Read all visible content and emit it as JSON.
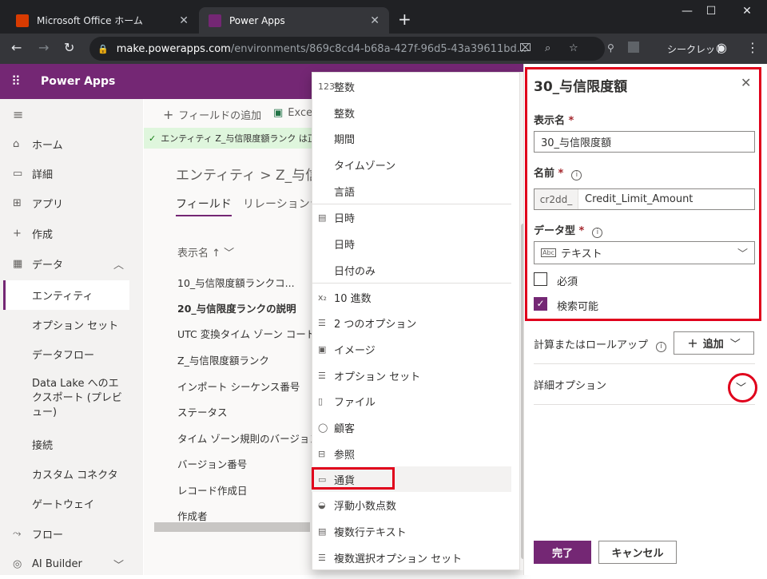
{
  "browser": {
    "tabs": [
      {
        "title": "Microsoft Office ホーム",
        "color": "#d83b01"
      },
      {
        "title": "Power Apps",
        "color": "#742774"
      }
    ],
    "url_host": "make.powerapps.com",
    "url_path": "/environments/869c8cd4-b68a-427f-96d5-43a39611bd...",
    "incognito": "シークレット"
  },
  "app": {
    "name": "Power Apps"
  },
  "nav": {
    "items": [
      {
        "label": "ホーム",
        "icon": "⌂"
      },
      {
        "label": "詳細",
        "icon": "▭"
      },
      {
        "label": "アプリ",
        "icon": "⊞"
      },
      {
        "label": "作成",
        "icon": "+"
      },
      {
        "label": "データ",
        "icon": "▦"
      },
      {
        "label": "エンティティ"
      },
      {
        "label": "オプション セット"
      },
      {
        "label": "データフロー"
      },
      {
        "label": "Data Lake へのエクスポート (プレビュー)"
      },
      {
        "label": "接続"
      },
      {
        "label": "カスタム コネクタ"
      },
      {
        "label": "ゲートウェイ"
      },
      {
        "label": "フロー",
        "icon": "⤳"
      },
      {
        "label": "AI Builder",
        "icon": "◎"
      }
    ]
  },
  "main": {
    "cmd_add": "フィールドの追加",
    "cmd_excel": "Excel",
    "notice": "エンティティ Z_与信限度額ランク は正",
    "breadcrumb": "エンティティ  >  Z_与信",
    "tabs": [
      "フィールド",
      "リレーションシ"
    ],
    "col_header": "表示名 ↑",
    "rows": [
      "10_与信限度額ランクコ...",
      "20_与信限度ランクの説明",
      "UTC 変換タイム ゾーン コード",
      "Z_与信限度額ランク",
      "インポート シーケンス番号",
      "ステータス",
      "タイム ゾーン規則のバージョン",
      "バージョン番号",
      "レコード作成日",
      "作成者"
    ]
  },
  "dropdown": {
    "items": [
      {
        "label": "整数",
        "type": "head",
        "icon": "123"
      },
      {
        "label": "整数",
        "type": "sub"
      },
      {
        "label": "期間",
        "type": "sub"
      },
      {
        "label": "タイムゾーン",
        "type": "sub"
      },
      {
        "label": "言語",
        "type": "sub"
      },
      {
        "label": "日時",
        "type": "head",
        "icon": "▤"
      },
      {
        "label": "日時",
        "type": "sub"
      },
      {
        "label": "日付のみ",
        "type": "sub"
      },
      {
        "label": "10 進数",
        "type": "head",
        "icon": "x₂"
      },
      {
        "label": "2 つのオプション",
        "type": "head",
        "icon": "☰"
      },
      {
        "label": "イメージ",
        "type": "head",
        "icon": "▣"
      },
      {
        "label": "オプション セット",
        "type": "head",
        "icon": "☰"
      },
      {
        "label": "ファイル",
        "type": "head",
        "icon": "▯"
      },
      {
        "label": "顧客",
        "type": "head",
        "icon": "◯"
      },
      {
        "label": "参照",
        "type": "head",
        "icon": "⊟"
      },
      {
        "label": "通貨",
        "type": "head",
        "icon": "▭"
      },
      {
        "label": "浮動小数点数",
        "type": "head",
        "icon": "◒"
      },
      {
        "label": "複数行テキスト",
        "type": "head",
        "icon": "▤"
      },
      {
        "label": "複数選択オプション セット",
        "type": "head",
        "icon": "☰"
      }
    ]
  },
  "panel": {
    "title": "30_与信限度額",
    "display_name_label": "表示名",
    "display_name_value": "30_与信限度額",
    "name_label": "名前",
    "name_prefix": "cr2dd_",
    "name_value": "Credit_Limit_Amount",
    "datatype_label": "データ型",
    "datatype_value": "テキスト",
    "required_label": "必須",
    "searchable_label": "検索可能",
    "searchable_checked": true,
    "calc_label": "計算またはロールアップ",
    "add_label": "追加",
    "advanced_label": "詳細オプション",
    "done_label": "完了",
    "cancel_label": "キャンセル",
    "req_mark": "*"
  },
  "colors": {
    "accent": "#742774",
    "highlight": "#e0001b"
  }
}
